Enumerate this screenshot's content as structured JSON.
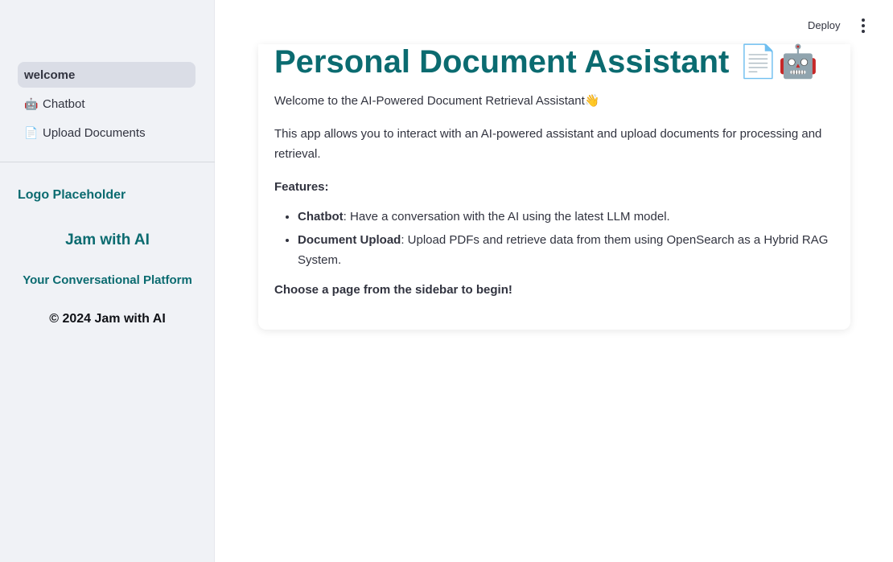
{
  "sidebar": {
    "nav": [
      {
        "label": "welcome",
        "icon": "",
        "active": true
      },
      {
        "label": "Chatbot",
        "icon": "🤖",
        "active": false
      },
      {
        "label": "Upload Documents",
        "icon": "📄",
        "active": false
      }
    ],
    "logo_placeholder": "Logo Placeholder",
    "brand_title": "Jam with AI",
    "brand_subtitle": "Your Conversational Platform",
    "copyright": "© 2024 Jam with AI"
  },
  "header": {
    "deploy_label": "Deploy",
    "menu_icon": "more-vertical-icon"
  },
  "main": {
    "title": "Personal Document Assistant",
    "title_emojis": "📄🤖",
    "welcome_text": "Welcome to the AI-Powered Document Retrieval Assistant",
    "welcome_emoji": "👋",
    "intro_text": "This app allows you to interact with an AI-powered assistant and upload documents for processing and retrieval.",
    "features_heading": "Features:",
    "features": [
      {
        "name": "Chatbot",
        "desc": ": Have a conversation with the AI using the latest LLM model."
      },
      {
        "name": "Document Upload",
        "desc": ": Upload PDFs and retrieve data from them using OpenSearch as a Hybrid RAG System."
      }
    ],
    "closing_text": "Choose a page from the sidebar to begin!"
  },
  "colors": {
    "accent": "#0b6b70",
    "sidebar_bg": "#f0f2f6",
    "active_nav_bg": "#dadde6",
    "text": "#31333f"
  }
}
